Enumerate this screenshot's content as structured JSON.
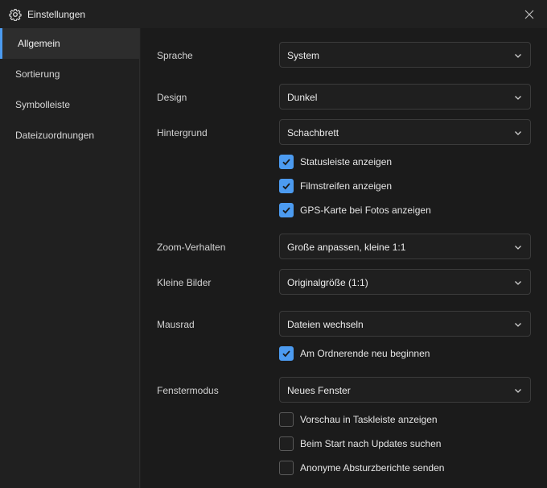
{
  "window": {
    "title": "Einstellungen"
  },
  "sidebar": {
    "items": [
      {
        "label": "Allgemein",
        "active": true
      },
      {
        "label": "Sortierung",
        "active": false
      },
      {
        "label": "Symbolleiste",
        "active": false
      },
      {
        "label": "Dateizuordnungen",
        "active": false
      }
    ]
  },
  "settings": {
    "language": {
      "label": "Sprache",
      "value": "System"
    },
    "design": {
      "label": "Design",
      "value": "Dunkel"
    },
    "background": {
      "label": "Hintergrund",
      "value": "Schachbrett"
    },
    "show_statusbar": {
      "label": "Statusleiste anzeigen",
      "checked": true
    },
    "show_filmstrip": {
      "label": "Filmstreifen anzeigen",
      "checked": true
    },
    "show_gps_map": {
      "label": "GPS-Karte bei Fotos anzeigen",
      "checked": true
    },
    "zoom": {
      "label": "Zoom-Verhalten",
      "value": "Große anpassen, kleine 1:1"
    },
    "small_images": {
      "label": "Kleine Bilder",
      "value": "Originalgröße (1:1)"
    },
    "mouse_wheel": {
      "label": "Mausrad",
      "value": "Dateien wechseln"
    },
    "restart_at_end": {
      "label": "Am Ordnerende neu beginnen",
      "checked": true
    },
    "window_mode": {
      "label": "Fenstermodus",
      "value": "Neues Fenster"
    },
    "taskbar_preview": {
      "label": "Vorschau in Taskleiste anzeigen",
      "checked": false
    },
    "check_updates": {
      "label": "Beim Start nach Updates suchen",
      "checked": false
    },
    "crash_reports": {
      "label": "Anonyme Absturzberichte senden",
      "checked": false
    }
  },
  "colors": {
    "accent": "#4c9bf0",
    "background": "#202020",
    "content_bg": "#1b1b1b"
  },
  "icons": {
    "title": "gear-icon",
    "close": "close-icon",
    "dropdown": "chevron-down-icon",
    "check": "checkmark-icon"
  }
}
